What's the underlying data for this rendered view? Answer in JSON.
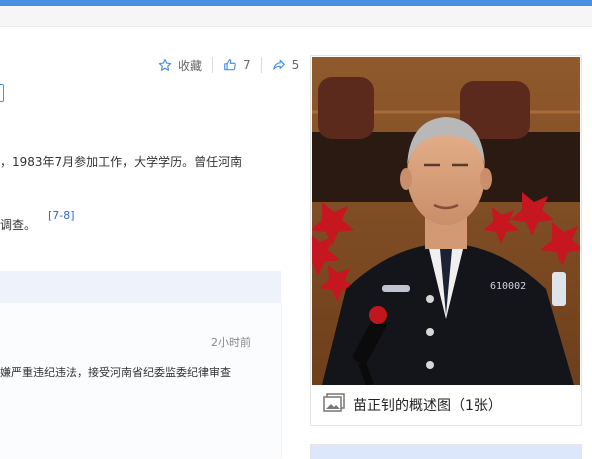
{
  "actions": {
    "collect_label": "收藏",
    "like_count": "7",
    "share_count": "5"
  },
  "article": {
    "para1": "，1983年7月参加工作，大学学历。曾任河南",
    "para2": "调查。",
    "citation": "[7-8]"
  },
  "news": {
    "time": "2小时前",
    "snippet": "嫌严重违纪违法，接受河南省纪委监委纪律审查"
  },
  "album": {
    "caption": "苗正钊的概述图（1张）",
    "badge_number": "610002"
  },
  "colors": {
    "accent": "#4a90e2",
    "link": "#3366cc"
  }
}
